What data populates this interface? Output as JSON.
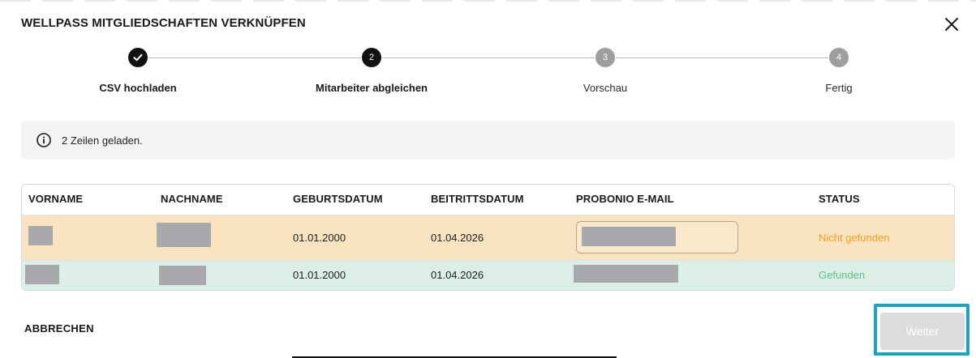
{
  "dialog": {
    "title": "WELLPASS MITGLIEDSCHAFTEN VERKNÜPFEN",
    "close_icon": "close-icon"
  },
  "stepper": {
    "steps": [
      {
        "number": "1",
        "label": "CSV hochladen",
        "state": "done",
        "icon": "check-icon"
      },
      {
        "number": "2",
        "label": "Mitarbeiter abgleichen",
        "state": "active"
      },
      {
        "number": "3",
        "label": "Vorschau",
        "state": "todo"
      },
      {
        "number": "4",
        "label": "Fertig",
        "state": "todo"
      }
    ]
  },
  "info": {
    "icon": "info-icon",
    "text": "2 Zeilen geladen."
  },
  "table": {
    "columns": [
      "VORNAME",
      "NACHNAME",
      "GEBURTSDATUM",
      "BEITRITTSDATUM",
      "PROBONIO E-MAIL",
      "STATUS"
    ],
    "rows": [
      {
        "vorname": "",
        "nachname": "",
        "geburtsdatum": "01.01.2000",
        "beitrittsdatum": "01.04.2026",
        "email": "",
        "status": "Nicht gefunden",
        "status_color": "#f0a020",
        "row_color": "#f9e3c0"
      },
      {
        "vorname": "",
        "nachname": "",
        "geburtsdatum": "01.01.2000",
        "beitrittsdatum": "01.04.2026",
        "email": "",
        "status": "Gefunden",
        "status_color": "#5cc08a",
        "row_color": "#dcefe7"
      }
    ]
  },
  "footer": {
    "cancel_label": "ABBRECHEN",
    "next_label": "Weiter",
    "highlight_color": "#1aa3bf"
  }
}
